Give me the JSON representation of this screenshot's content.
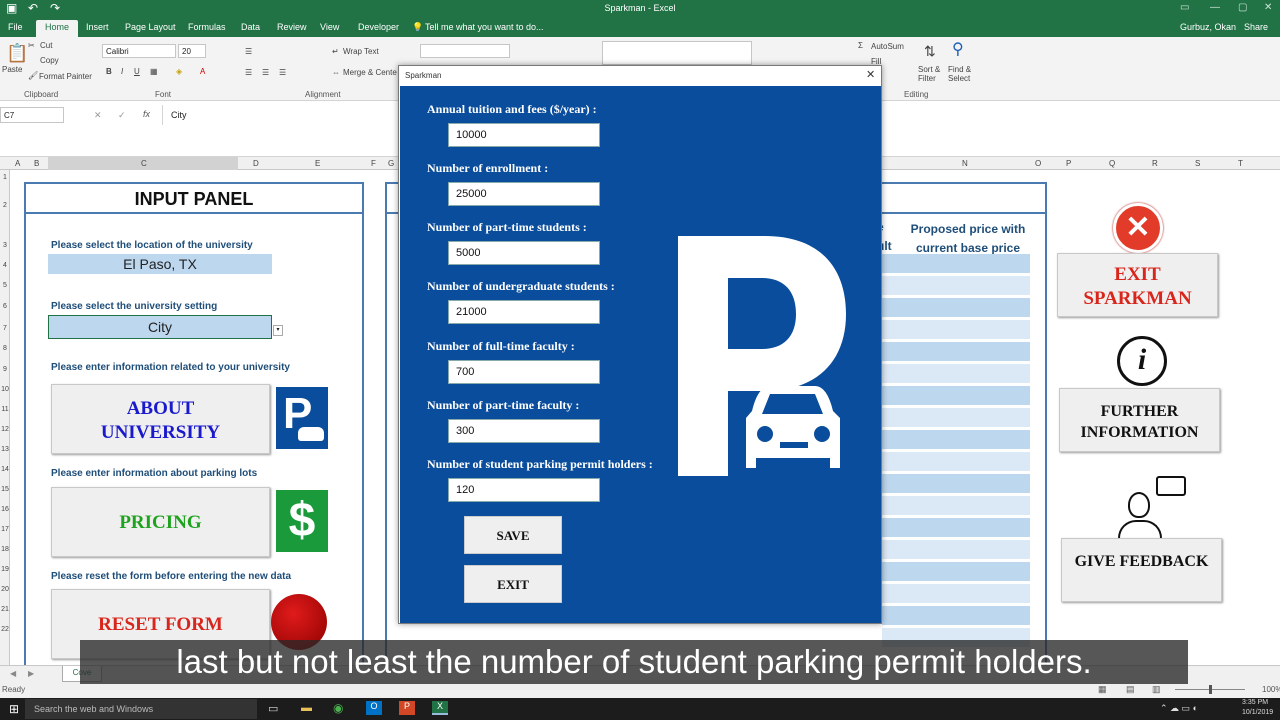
{
  "window": {
    "title": "Sparkman - Excel",
    "user": "Gurbuz, Okan",
    "share": "Share"
  },
  "tabs": [
    "File",
    "Home",
    "Insert",
    "Page Layout",
    "Formulas",
    "Data",
    "Review",
    "View",
    "Developer"
  ],
  "tell_me": "Tell me what you want to do...",
  "ribbon": {
    "clipboard": {
      "paste": "Paste",
      "cut": "Cut",
      "copy": "Copy",
      "format_painter": "Format Painter",
      "group": "Clipboard"
    },
    "font": {
      "name": "Calibri",
      "size": "20",
      "group": "Font"
    },
    "alignment": {
      "wrap": "Wrap Text",
      "merge": "Merge & Cente",
      "group": "Alignment"
    },
    "editing": {
      "autosum": "AutoSum",
      "fill": "Fill",
      "sort": "Sort & Filter",
      "find": "Find & Select",
      "group": "Editing"
    }
  },
  "formula_bar": {
    "cell_ref": "C7",
    "value": "City"
  },
  "columns": [
    "A",
    "B",
    "C",
    "D",
    "E",
    "F",
    "G",
    "N",
    "O",
    "P",
    "Q",
    "R",
    "S",
    "T"
  ],
  "rows": [
    "1",
    "2",
    "3",
    "4",
    "5",
    "6",
    "7",
    "8",
    "9",
    "10",
    "11",
    "12",
    "13",
    "14",
    "15",
    "16",
    "17",
    "18",
    "19",
    "20",
    "21",
    "22"
  ],
  "input_panel": {
    "title": "INPUT PANEL",
    "location_label": "Please select the location of the university",
    "location_value": "El Paso, TX",
    "setting_label": "Please select the university setting",
    "setting_value": "City",
    "univ_info_label": "Please enter information related to your university",
    "about_button": "ABOUT UNIVERSITY",
    "parking_label": "Please enter information about parking lots",
    "pricing_button": "PRICING",
    "reset_label": "Please reset the form before entering the new data",
    "reset_button": "RESET FORM"
  },
  "output_panel": {
    "proposed_header": "Proposed price with current base price",
    "partial_header": "ult",
    "partial_header2": "e"
  },
  "right_buttons": {
    "exit": "EXIT SPARKMAN",
    "further": "FURTHER INFORMATION",
    "feedback": "GIVE FEEDBACK"
  },
  "dialog": {
    "title": "Sparkman",
    "fields": [
      {
        "label": "Annual tuition and fees ($/year) :",
        "value": "10000"
      },
      {
        "label": "Number of enrollment :",
        "value": "25000"
      },
      {
        "label": "Number of part-time students :",
        "value": "5000"
      },
      {
        "label": "Number of undergraduate students :",
        "value": "21000"
      },
      {
        "label": "Number of full-time faculty :",
        "value": "700"
      },
      {
        "label": "Number of part-time faculty :",
        "value": "300"
      },
      {
        "label": "Number of student parking permit holders :",
        "value": "120"
      }
    ],
    "save": "SAVE",
    "exit": "EXIT"
  },
  "sheet_tab": "Cove",
  "status": {
    "ready": "Ready",
    "zoom": "100%"
  },
  "taskbar": {
    "search": "Search the web and Windows",
    "time": "3:35 PM",
    "date": "10/1/2019"
  },
  "caption": "last but not least the number of student parking permit holders.",
  "colors": {
    "excel_green": "#217346",
    "dialog_blue": "#0a4d9c",
    "panel_border": "#4a7ab0",
    "exit_red": "#d9261c",
    "pricing_green": "#1fa31f",
    "about_blue": "#1a1acc"
  }
}
